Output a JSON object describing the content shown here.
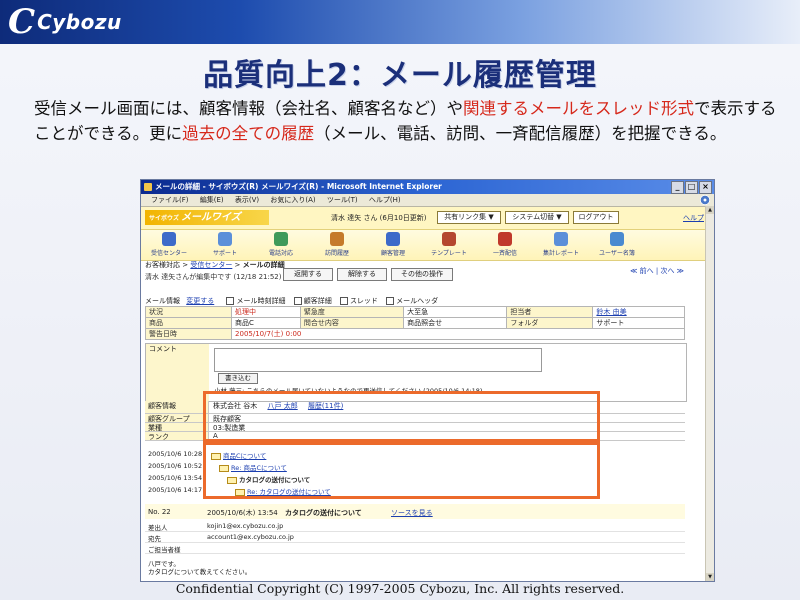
{
  "slide": {
    "logo_mark": "C",
    "logo_text": "Cybozu",
    "title": "品質向上2：メール履歴管理",
    "desc_parts": [
      "受信メール画面には、顧客情報（会社名、顧客名など）や",
      "関連するメールをスレッド形式",
      "で表示することができる。更に",
      "過去の全ての履歴",
      "（メール、電話、訪問、一斉配信履歴）を把握できる。"
    ],
    "footer": "Confidential   Copyright (C) 1997-2005 Cybozu, Inc. All rights reserved."
  },
  "browser": {
    "title": "メールの詳細 - サイボウズ(R) メールワイズ(R) - Microsoft Internet Explorer",
    "win_buttons": [
      "_",
      "□",
      "×"
    ],
    "menu": [
      "ファイル(F)",
      "編集(E)",
      "表示(V)",
      "お気に入り(A)",
      "ツール(T)",
      "ヘルプ(H)"
    ]
  },
  "app": {
    "logo_small": "サイボウズ",
    "logo": "メールワイズ",
    "username": "清水 達矢 さん (6月10日更新)",
    "buttons": [
      "共有リンク集 ▼",
      "システム切替 ▼",
      "ログアウト"
    ],
    "help": "ヘルプ",
    "nav": [
      "受信センター",
      "サポート",
      "電話対応",
      "訪問履歴",
      "顧客管理",
      "テンプレート",
      "一斉配信",
      "集計レポート",
      "ユーザー名簿"
    ],
    "nav_colors": [
      "#3d6ac9",
      "#5b8fd9",
      "#3f9a5a",
      "#c57a2a",
      "#3d6ac9",
      "#b5472f",
      "#c0392b",
      "#5b8fd9",
      "#4a8ad0"
    ]
  },
  "detail": {
    "breadcrumb_root": "お客様対応",
    "breadcrumb_mid": "受信センター",
    "breadcrumb_current": "メールの詳細",
    "editing": "清水 達矢さんが編集中です (12/18 21:52)",
    "actions": [
      "返開する",
      "解除する",
      "その他の操作"
    ],
    "pager": "≪ 前へ | 次へ ≫",
    "mail_info_label": "メール情報",
    "edit_link": "変更する",
    "checks": [
      "メール時刻詳細",
      "顧客詳細",
      "スレッド",
      "メールヘッダ"
    ],
    "grid": [
      [
        "状況",
        "処理中",
        "緊急度",
        "大至急",
        "担当者",
        "鈴木 由美"
      ],
      [
        "商品",
        "商品C",
        "問合せ内容",
        "商品照会せ",
        "フォルダ",
        "サポート"
      ]
    ],
    "warn_label": "警告日時",
    "warn_value": "2005/10/7(土) 0:00",
    "comment_label": "コメント",
    "write_button": "書き込む",
    "comment_text": "小林 藤三: こちらのメール届いていないようなので再送信してください (2005/10/6 14:18)"
  },
  "customer": {
    "label": "顧客情報",
    "company": "株式会社 谷木",
    "person": "八戸 太郎",
    "history": "履歴(11件)",
    "rows": [
      [
        "顧客グループ",
        "既存顧客"
      ],
      [
        "業種",
        "03:製造業"
      ],
      [
        "ランク",
        "A"
      ]
    ]
  },
  "thread": [
    {
      "date": "2005/10/6 10:28",
      "subject": "商品Cについて"
    },
    {
      "date": "2005/10/6 10:52",
      "subject": "Re: 商品Cについて"
    },
    {
      "date": "2005/10/6 13:54",
      "subject": "カタログの送付について"
    },
    {
      "date": "2005/10/6 14:17",
      "subject": "Re: カタログの送付について"
    }
  ],
  "mail": {
    "no": "No. 22",
    "datetime": "2005/10/6(木) 13:54",
    "subject": "カタログの送付について",
    "source_link": "ソースを見る",
    "from_label": "差出人",
    "from": "kojin1@ex.cybozu.co.jp",
    "to_label": "宛先",
    "to": "account1@ex.cybozu.co.jp",
    "attach_label": "ご担当者様",
    "body": [
      "八戸です。",
      "カタログについて教えてください。"
    ]
  }
}
